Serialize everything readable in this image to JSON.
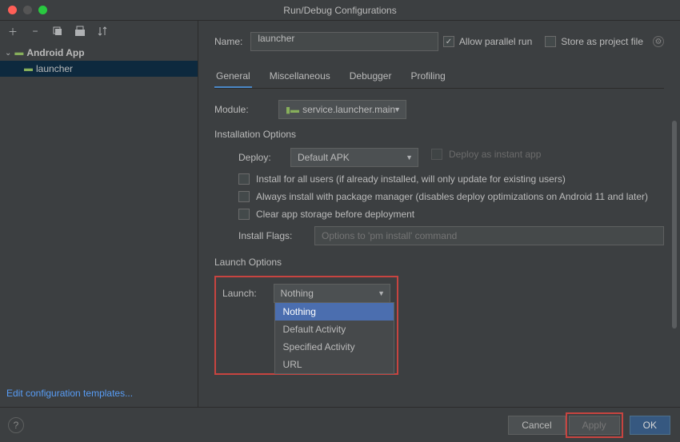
{
  "title": "Run/Debug Configurations",
  "sidebar": {
    "icons": [
      "add",
      "remove",
      "copy",
      "save",
      "sort"
    ],
    "group_label": "Android App",
    "items": [
      {
        "label": "launcher",
        "selected": true
      }
    ],
    "edit_templates": "Edit configuration templates..."
  },
  "header": {
    "name_label": "Name:",
    "name_value": "launcher",
    "allow_parallel_label": "Allow parallel run",
    "allow_parallel_checked": true,
    "store_project_label": "Store as project file",
    "store_project_checked": false
  },
  "tabs": [
    {
      "label": "General",
      "active": true
    },
    {
      "label": "Miscellaneous",
      "active": false
    },
    {
      "label": "Debugger",
      "active": false
    },
    {
      "label": "Profiling",
      "active": false
    }
  ],
  "module": {
    "label": "Module:",
    "value": "service.launcher.main"
  },
  "install_options": {
    "title": "Installation Options",
    "deploy_label": "Deploy:",
    "deploy_value": "Default APK",
    "instant_app_label": "Deploy as instant app",
    "instant_app_checked": false,
    "install_all_label": "Install for all users (if already installed, will only update for existing users)",
    "always_pm_label": "Always install with package manager (disables deploy optimizations on Android 11 and later)",
    "clear_storage_label": "Clear app storage before deployment",
    "install_flags_label": "Install Flags:",
    "install_flags_placeholder": "Options to 'pm install' command"
  },
  "launch_options": {
    "title": "Launch Options",
    "launch_label": "Launch:",
    "launch_value": "Nothing",
    "menu": [
      {
        "label": "Nothing",
        "selected": true
      },
      {
        "label": "Default Activity",
        "selected": false
      },
      {
        "label": "Specified Activity",
        "selected": false
      },
      {
        "label": "URL",
        "selected": false
      }
    ]
  },
  "footer": {
    "cancel": "Cancel",
    "apply": "Apply",
    "ok": "OK"
  }
}
